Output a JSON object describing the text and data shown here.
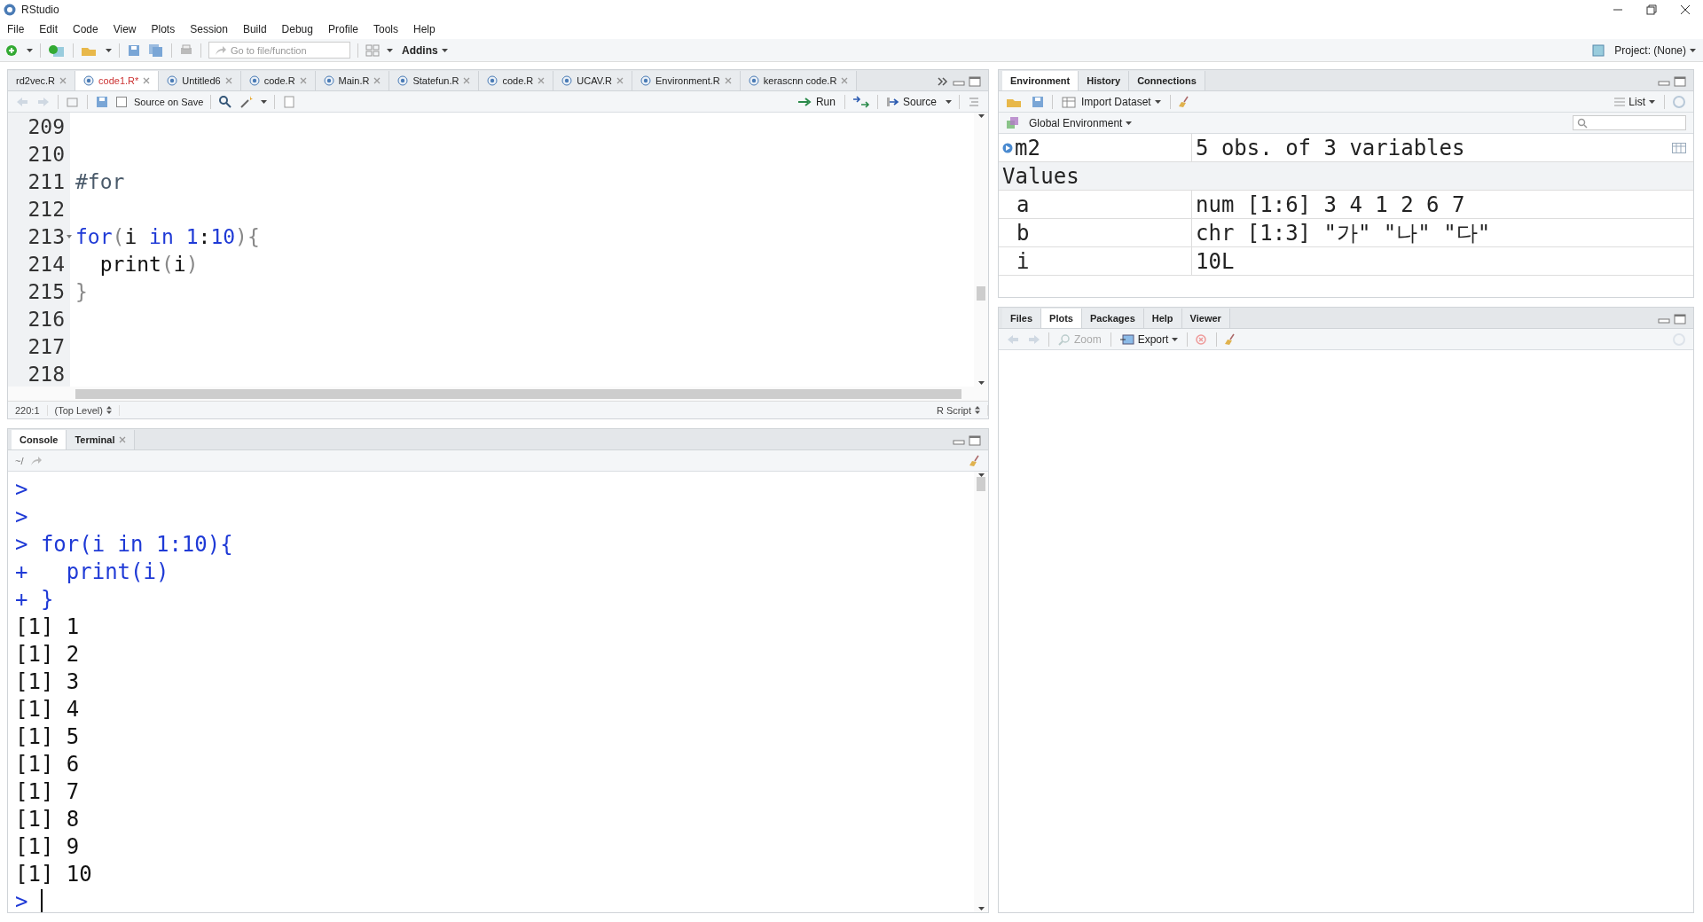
{
  "window": {
    "title": "RStudio"
  },
  "menu": [
    "File",
    "Edit",
    "Code",
    "View",
    "Plots",
    "Session",
    "Build",
    "Debug",
    "Profile",
    "Tools",
    "Help"
  ],
  "toolbar": {
    "goto_placeholder": "Go to file/function",
    "addins": "Addins",
    "project": "Project: (None)"
  },
  "editor": {
    "tabs": [
      {
        "label": "rd2vec.R",
        "selected": false
      },
      {
        "label": "code1.R*",
        "selected": true
      },
      {
        "label": "Untitled6",
        "selected": false
      },
      {
        "label": "code.R",
        "selected": false
      },
      {
        "label": "Main.R",
        "selected": false
      },
      {
        "label": "Statefun.R",
        "selected": false
      },
      {
        "label": "code.R",
        "selected": false
      },
      {
        "label": "UCAV.R",
        "selected": false
      },
      {
        "label": "Environment.R",
        "selected": false
      },
      {
        "label": "kerascnn code.R",
        "selected": false
      }
    ],
    "source_on_save": {
      "label": "Source on Save",
      "checked": false
    },
    "run": "Run",
    "source": "Source",
    "lines": [
      {
        "number": "209",
        "fold": false
      },
      {
        "number": "210",
        "fold": false
      },
      {
        "number": "211",
        "fold": false,
        "tokens": [
          {
            "text": "#for",
            "kind": "comment"
          }
        ]
      },
      {
        "number": "212",
        "fold": false
      },
      {
        "number": "213",
        "fold": true,
        "tokens": [
          {
            "text": "for",
            "kind": "keyword"
          },
          {
            "text": "(",
            "kind": "paren"
          },
          {
            "text": "i ",
            "kind": "plain"
          },
          {
            "text": "in",
            "kind": "keyword"
          },
          {
            "text": " 1",
            "kind": "number"
          },
          {
            "text": ":",
            "kind": "plain"
          },
          {
            "text": "10",
            "kind": "number"
          },
          {
            "text": "){",
            "kind": "paren"
          }
        ]
      },
      {
        "number": "214",
        "fold": false,
        "tokens": [
          {
            "text": "  print",
            "kind": "plain"
          },
          {
            "text": "(",
            "kind": "paren"
          },
          {
            "text": "i",
            "kind": "plain"
          },
          {
            "text": ")",
            "kind": "paren"
          }
        ]
      },
      {
        "number": "215",
        "fold": false,
        "tokens": [
          {
            "text": "}",
            "kind": "paren"
          }
        ]
      },
      {
        "number": "216",
        "fold": false
      },
      {
        "number": "217",
        "fold": false
      },
      {
        "number": "218",
        "fold": false
      }
    ],
    "status": {
      "position": "220:1",
      "scope": "(Top Level)",
      "type": "R Script"
    }
  },
  "console": {
    "tabs": [
      {
        "label": "Console",
        "selected": true,
        "closable": false
      },
      {
        "label": "Terminal",
        "selected": false,
        "closable": true
      }
    ],
    "path": "~/",
    "lines": [
      {
        "kind": "input",
        "prompt": ">"
      },
      {
        "kind": "input",
        "prompt": ">"
      },
      {
        "kind": "input",
        "prompt": ">",
        "text": "for(i in 1:10){"
      },
      {
        "kind": "input",
        "prompt": "+",
        "text": "  print(i)"
      },
      {
        "kind": "input",
        "prompt": "+",
        "text": "}"
      },
      {
        "kind": "output",
        "text": "[1] 1"
      },
      {
        "kind": "output",
        "text": "[1] 2"
      },
      {
        "kind": "output",
        "text": "[1] 3"
      },
      {
        "kind": "output",
        "text": "[1] 4"
      },
      {
        "kind": "output",
        "text": "[1] 5"
      },
      {
        "kind": "output",
        "text": "[1] 6"
      },
      {
        "kind": "output",
        "text": "[1] 7"
      },
      {
        "kind": "output",
        "text": "[1] 8"
      },
      {
        "kind": "output",
        "text": "[1] 9"
      },
      {
        "kind": "output",
        "text": "[1] 10"
      },
      {
        "kind": "cursor",
        "prompt": ">"
      }
    ]
  },
  "environment": {
    "tabs": [
      {
        "label": "Environment",
        "selected": true
      },
      {
        "label": "History",
        "selected": false
      },
      {
        "label": "Connections",
        "selected": false
      }
    ],
    "import": "Import Dataset",
    "view": "List",
    "scope": "Global Environment",
    "data_rows": [
      {
        "name": "m2",
        "value": "5 obs. of 3 variables"
      }
    ],
    "values_header": "Values",
    "value_rows": [
      {
        "name": "a",
        "value": "num [1:6] 3 4 1 2 6 7"
      },
      {
        "name": "b",
        "value": "chr [1:3] \"가\" \"나\" \"다\""
      },
      {
        "name": "i",
        "value": "10L"
      }
    ]
  },
  "files": {
    "tabs": [
      {
        "label": "Files",
        "selected": false
      },
      {
        "label": "Plots",
        "selected": true
      },
      {
        "label": "Packages",
        "selected": false
      },
      {
        "label": "Help",
        "selected": false
      },
      {
        "label": "Viewer",
        "selected": false
      }
    ],
    "zoom": {
      "label": "Zoom",
      "disabled": true
    },
    "export": {
      "label": "Export",
      "disabled": false
    }
  }
}
